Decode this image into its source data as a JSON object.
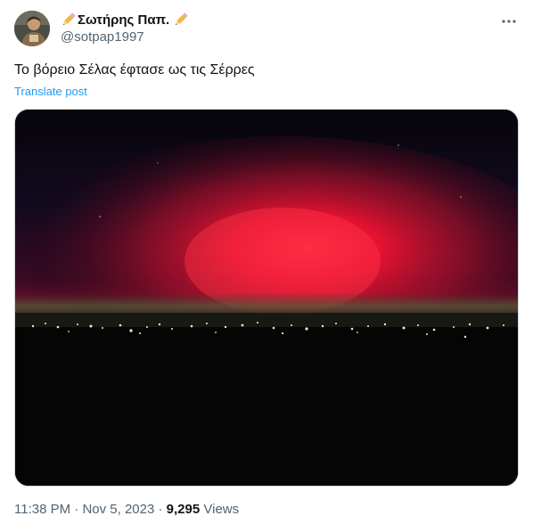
{
  "author": {
    "display_name": "Σωτήρης Παπ.",
    "handle": "@sotpap1997",
    "name_decoration_icon": "pencil-icon",
    "avatar_icon": "avatar"
  },
  "menu": {
    "more_icon": "more-horizontal-icon"
  },
  "post": {
    "text": "Το βόρειο Σέλας έφτασε ως τις Σέρρες",
    "translate_label": "Translate post"
  },
  "media": {
    "description_icon": "photo-aurora"
  },
  "meta": {
    "time": "11:38 PM",
    "separator_1": " · ",
    "date": "Nov 5, 2023",
    "separator_2": " · ",
    "views_count": "9,295",
    "views_label": " Views"
  },
  "colors": {
    "text_primary": "#0f1419",
    "text_secondary": "#536471",
    "link": "#1d9bf0",
    "aurora_red": "#ff1a3a",
    "sky_dark": "#0a0714"
  }
}
